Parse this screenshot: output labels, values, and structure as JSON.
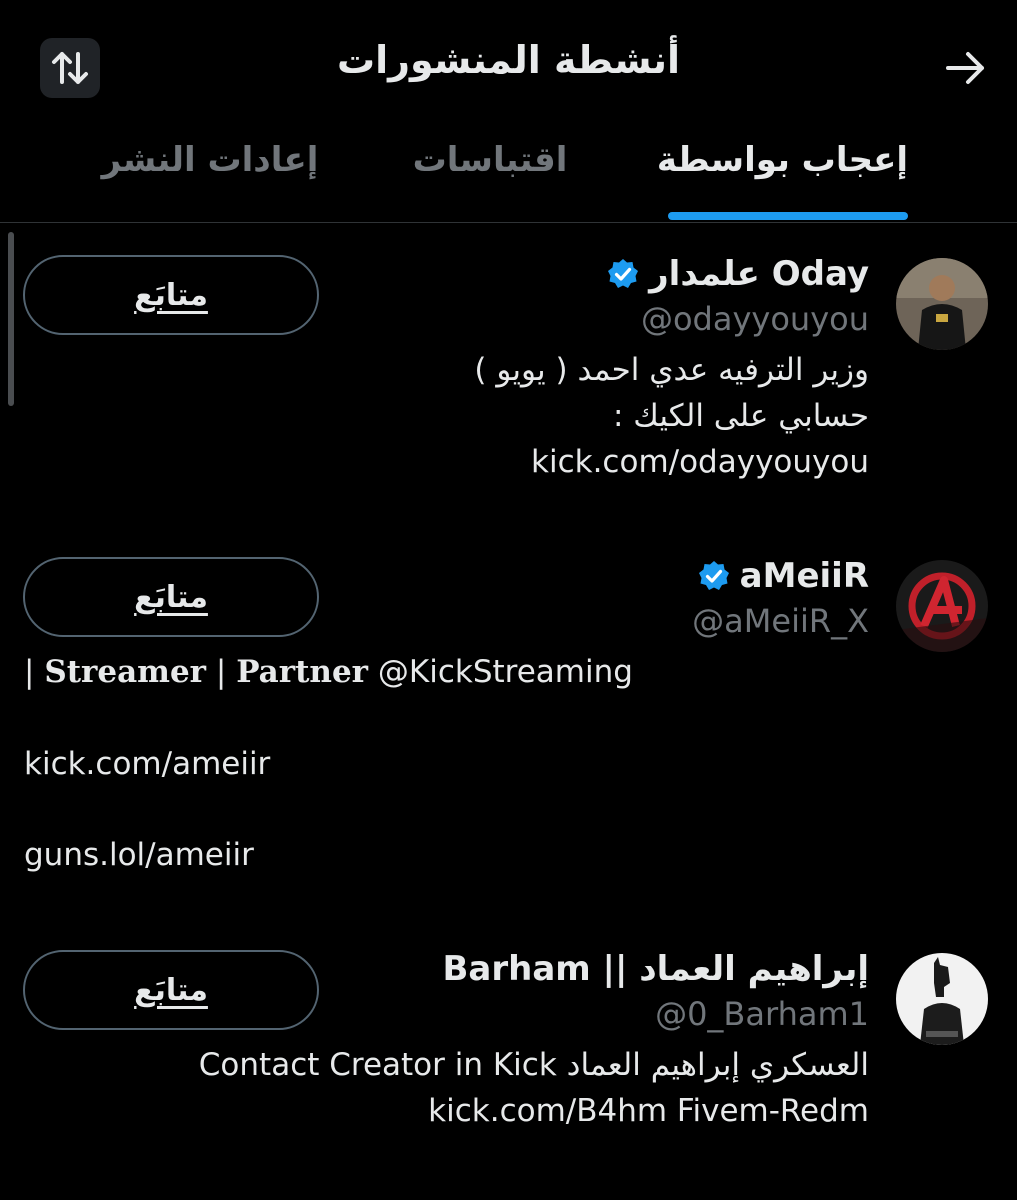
{
  "header": {
    "title": "أنشطة المنشورات",
    "sort_icon": "swap-vertical-icon",
    "back_icon": "arrow-right-icon"
  },
  "tabs": [
    {
      "label": "إعادات النشر",
      "active": false
    },
    {
      "label": "اقتباسات",
      "active": false
    },
    {
      "label": "إعجاب بواسطة",
      "active": true
    }
  ],
  "users": [
    {
      "name": "علمدار Oday",
      "verified": true,
      "handle": "@odayyouyou",
      "button_label": "متابَع",
      "bio": [
        "وزير الترفيه عدي احمد ( يويو )",
        "حسابي على الكيك :",
        "kick.com/odayyouyou"
      ]
    },
    {
      "name": "aMeiiR",
      "verified": true,
      "handle": "@aMeiiR_X",
      "button_label": "متابَع",
      "bio_parts": {
        "bar1": "|",
        "streamer": "Streamer",
        "bar2": "|",
        "partner": "Partner",
        "mention": "@KickStreaming"
      },
      "bio_links": [
        "kick.com/ameiir",
        "guns.lol/ameiir"
      ]
    },
    {
      "name": "إبراهيم العماد || Barham",
      "verified": false,
      "handle": "@0_Barham1",
      "button_label": "متابَع",
      "bio": [
        "العسكري إبراهيم العماد Contact Creator in Kick",
        "kick.com/B4hm Fivem-Redm"
      ]
    }
  ],
  "colors": {
    "background": "#000000",
    "text": "#e7e9ea",
    "muted": "#71767b",
    "accent": "#1d9bf0",
    "border": "#536471"
  }
}
